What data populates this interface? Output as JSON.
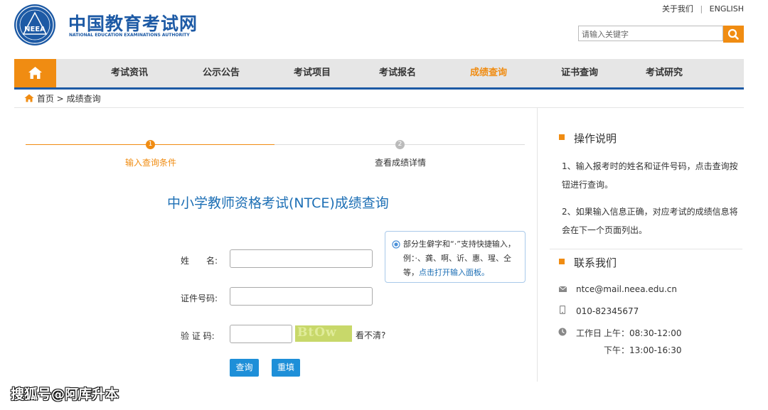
{
  "header": {
    "logo_badge": "NEEA",
    "site_title": "中国教育考试网",
    "site_subtitle": "NATIONAL EDUCATION EXAMINATIONS AUTHORITY",
    "top_links": [
      "关于我们",
      "ENGLISH"
    ],
    "top_separator": "|",
    "search_placeholder": "请输入关键字",
    "accent_color": "#f08c12",
    "brand_color": "#1d5aa5"
  },
  "nav": {
    "items": [
      "考试资讯",
      "公示公告",
      "考试项目",
      "考试报名",
      "成绩查询",
      "证书查询",
      "考试研究"
    ],
    "active_item": "成绩查询"
  },
  "breadcrumb": {
    "home": "首页",
    "separator": ">",
    "current": "成绩查询"
  },
  "steps": [
    {
      "number": "1",
      "label": "输入查询条件",
      "active": true
    },
    {
      "number": "2",
      "label": "查看成绩详情",
      "active": false
    }
  ],
  "form": {
    "title": "中小学教师资格考试(NTCE)成绩查询",
    "name_label": "姓　　名:",
    "id_label": "证件号码:",
    "captcha_label": "验 证 码:",
    "name_value": "",
    "id_value": "",
    "captcha_value": "",
    "captcha_image_text": "BtOw",
    "refresh_captcha": "看不清?",
    "submit_button": "查询",
    "reset_button": "重填",
    "tip": {
      "text": "部分生僻字和“·”支持快捷输入，例：·、龚、啊、䜣、惠、瑆、仝等，",
      "link": "点击打开输入面板。"
    }
  },
  "sidebar": {
    "instructions_title": "操作说明",
    "instructions": [
      "1、输入报考时的姓名和证件号码，点击查询按钮进行查询。",
      "2、如果输入信息正确，对应考试的成绩信息将会在下一个页面列出。"
    ],
    "contact_title": "联系我们",
    "email": "ntce@mail.neea.edu.cn",
    "phone": "010-82345677",
    "hours_label": "工作日",
    "hours_am": "上午：08:30-12:00",
    "hours_pm": "下午：13:00-16:30"
  },
  "watermark": "搜狐号@阿库升本"
}
